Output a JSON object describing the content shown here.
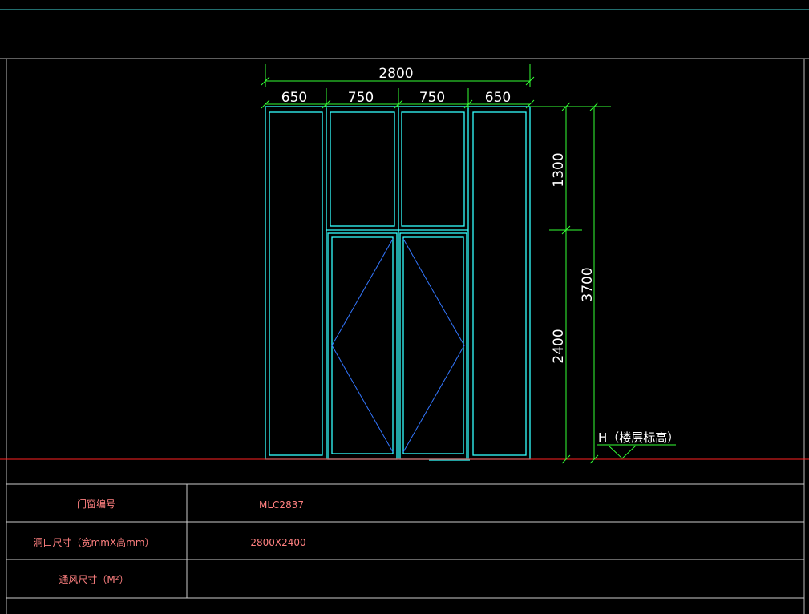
{
  "dimensions": {
    "overall_width": "2800",
    "panel_widths": [
      "650",
      "750",
      "750",
      "650"
    ],
    "upper_height": "1300",
    "lower_height": "2400",
    "total_height": "3700"
  },
  "level_mark": {
    "label": "H（楼层标高）"
  },
  "schedule_table": {
    "rows": [
      {
        "label": "门窗编号",
        "value": "MLC2837"
      },
      {
        "label": "洞口尺寸（宽mmX高mm）",
        "value": "2800X2400"
      },
      {
        "label": "通风尺寸（M²）",
        "value": ""
      }
    ]
  },
  "colors": {
    "frame": "#33ffff",
    "dimension": "#33ff33",
    "glazing_diagonal": "#3377ff",
    "ground_line": "#ff2222",
    "table_border": "#cccccc",
    "table_text": "#ff8080",
    "top_edge": "#44dddd"
  }
}
